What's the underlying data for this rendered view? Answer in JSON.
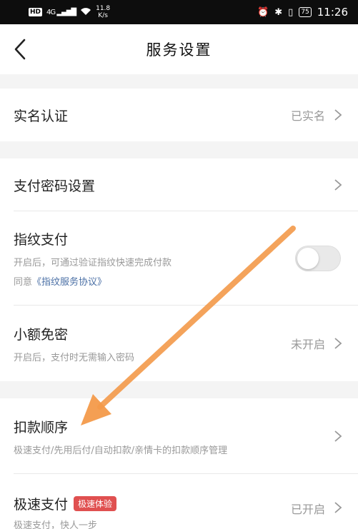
{
  "statusbar": {
    "hd": "HD",
    "network": "4G",
    "speed_value": "11.8",
    "speed_unit": "K/s",
    "battery": "75",
    "time": "11:26"
  },
  "header": {
    "title": "服务设置"
  },
  "rows": {
    "realname": {
      "label": "实名认证",
      "value": "已实名"
    },
    "password": {
      "label": "支付密码设置"
    },
    "fingerprint": {
      "label": "指纹支付",
      "desc": "开启后，可通过验证指纹快速完成付款",
      "agree_prefix": "同意",
      "agree_link": "《指纹服务协议》",
      "toggle_on": false
    },
    "smallpay": {
      "label": "小额免密",
      "desc": "开启后，支付时无需输入密码",
      "value": "未开启"
    },
    "order": {
      "label": "扣款顺序",
      "desc": "极速支付/先用后付/自动扣款/亲情卡的扣款顺序管理"
    },
    "fastpay": {
      "label": "极速支付",
      "badge": "极速体验",
      "desc": "极速支付，快人一步",
      "value": "已开启"
    }
  },
  "colors": {
    "arrow": "#f39a4a",
    "badge": "#e05050",
    "link": "#4a6fa5"
  }
}
